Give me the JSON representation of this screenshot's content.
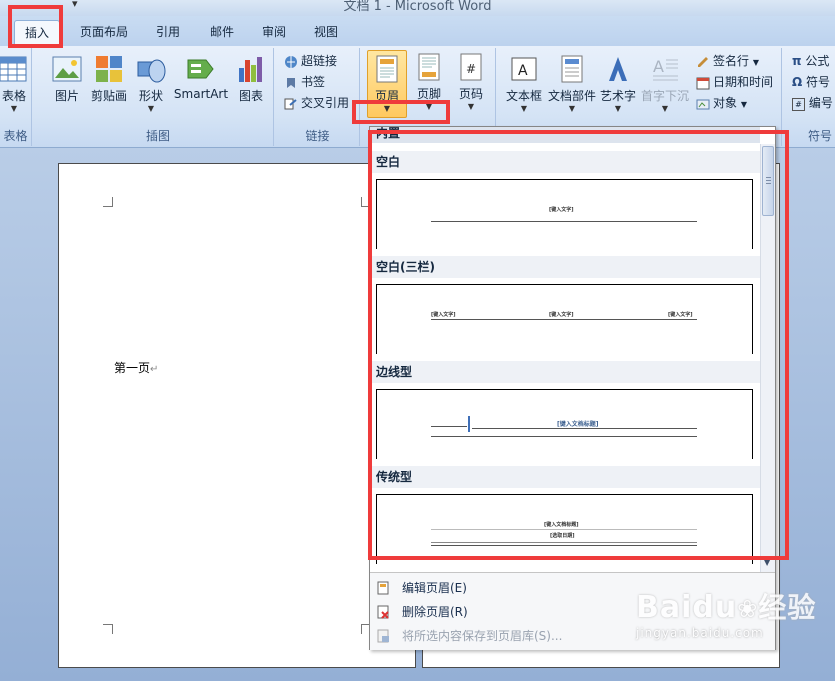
{
  "window": {
    "title": "文档 1 - Microsoft Word",
    "qat_more": "▾"
  },
  "tabs": [
    {
      "label": "插入",
      "active": true
    },
    {
      "label": "页面布局"
    },
    {
      "label": "引用"
    },
    {
      "label": "邮件"
    },
    {
      "label": "审阅"
    },
    {
      "label": "视图"
    }
  ],
  "ribbon": {
    "table_group": {
      "label": "表格",
      "button": "表格"
    },
    "illustrations": {
      "label": "插图",
      "picture": "图片",
      "clipart": "剪贴画",
      "shapes": "形状",
      "smartart": "SmartArt",
      "chart": "图表"
    },
    "links": {
      "label": "链接",
      "hyperlink": "超链接",
      "bookmark": "书签",
      "crossref": "交叉引用"
    },
    "header_footer": {
      "header": "页眉",
      "footer": "页脚",
      "page_number": "页码"
    },
    "text": {
      "textbox": "文本框",
      "quickparts": "文档部件",
      "wordart": "艺术字",
      "dropcap": "首字下沉",
      "signature": "签名行",
      "datetime": "日期和时间",
      "object": "对象"
    },
    "symbols": {
      "label": "符号",
      "equation": "公式",
      "symbol": "符号",
      "number": "编号"
    }
  },
  "document": {
    "page1_text": "第一页",
    "paragraph_mark": "↵"
  },
  "gallery": {
    "builtin_label": "内置",
    "sections": [
      {
        "name": "空白",
        "placeholders": [
          "[键入文字]"
        ]
      },
      {
        "name": "空白(三栏)",
        "placeholders": [
          "[键入文字]",
          "[键入文字]",
          "[键入文字]"
        ]
      },
      {
        "name": "边线型",
        "placeholders": [
          "[键入文档标题]"
        ]
      },
      {
        "name": "传统型",
        "placeholders": [
          "[键入文档标题]",
          "[选取日期]"
        ]
      }
    ],
    "menu": [
      {
        "label": "编辑页眉(E)",
        "enabled": true
      },
      {
        "label": "删除页眉(R)",
        "enabled": true
      },
      {
        "label": "将所选内容保存到页眉库(S)...",
        "enabled": false
      }
    ]
  },
  "watermark": {
    "brand": "Baidu",
    "cn": "经验",
    "url": "jingyan.baidu.com"
  },
  "colors": {
    "highlight": "#ef3b3b",
    "ribbon": "#d4e3f5",
    "active_button": "#ffc960"
  }
}
